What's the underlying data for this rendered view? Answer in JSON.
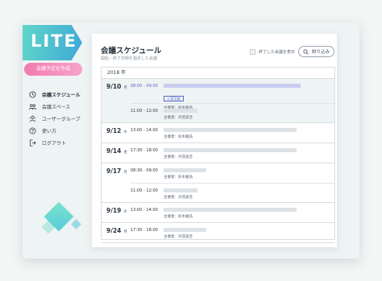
{
  "app": {
    "logo": "LITE",
    "create_button": "会議予定を作成"
  },
  "sidebar": {
    "items": [
      {
        "label": "会議スケジュール",
        "icon": "clock-icon",
        "active": true
      },
      {
        "label": "会議スペース",
        "icon": "people-icon",
        "active": false
      },
      {
        "label": "ユーザーグループ",
        "icon": "group-icon",
        "active": false
      },
      {
        "label": "使い方",
        "icon": "help-icon",
        "active": false
      },
      {
        "label": "ログアウト",
        "icon": "logout-icon",
        "active": false
      }
    ]
  },
  "header": {
    "title": "会議スケジュール",
    "subtitle": "開始・終了日時を指定した会議",
    "show_finished_label": "終了した会議を表示",
    "filter_button": "絞り込み"
  },
  "schedule": {
    "year": "2018 年",
    "days": [
      {
        "date": "9/10",
        "dow": "月",
        "selected": true,
        "events": [
          {
            "time": "08:00 - 09:00",
            "host": "主催者：鈴木雅浩",
            "tag": "入室可能",
            "accent": true,
            "bar": 0.8
          },
          {
            "time": "11:00 - 12:00",
            "host": "主催者：丹羽美佳",
            "tag": "",
            "accent": false,
            "bar": 0.2
          }
        ]
      },
      {
        "date": "9/12",
        "dow": "水",
        "events": [
          {
            "time": "13:00 - 14:00",
            "host": "主催者：鈴木雅浩",
            "tag": "",
            "accent": false,
            "bar": 0.78
          }
        ]
      },
      {
        "date": "9/14",
        "dow": "金",
        "events": [
          {
            "time": "17:30 - 18:00",
            "host": "主催者：丹羽美佳",
            "tag": "",
            "accent": false,
            "bar": 0.78
          }
        ]
      },
      {
        "date": "9/17",
        "dow": "月",
        "events": [
          {
            "time": "08:30 - 09:00",
            "host": "主催者：鈴木雅浩",
            "tag": "",
            "accent": false,
            "bar": 0.25
          },
          {
            "time": "11:00 - 12:00",
            "host": "主催者：丹羽美佳",
            "tag": "",
            "accent": false,
            "bar": 0.2
          }
        ]
      },
      {
        "date": "9/19",
        "dow": "水",
        "events": [
          {
            "time": "13:00 - 14:00",
            "host": "主催者：鈴木雅浩",
            "tag": "",
            "accent": false,
            "bar": 0.78
          }
        ]
      },
      {
        "date": "9/24",
        "dow": "月",
        "events": [
          {
            "time": "17:30 - 18:00",
            "host": "主催者：丹羽美佳",
            "tag": "",
            "accent": false,
            "bar": 0.25
          }
        ]
      }
    ]
  },
  "colors": {
    "accent": "#5a68c8",
    "logo_gradient_start": "#5fd6c8",
    "logo_gradient_end": "#3fa8d8",
    "create_button": "#f27bb0"
  }
}
